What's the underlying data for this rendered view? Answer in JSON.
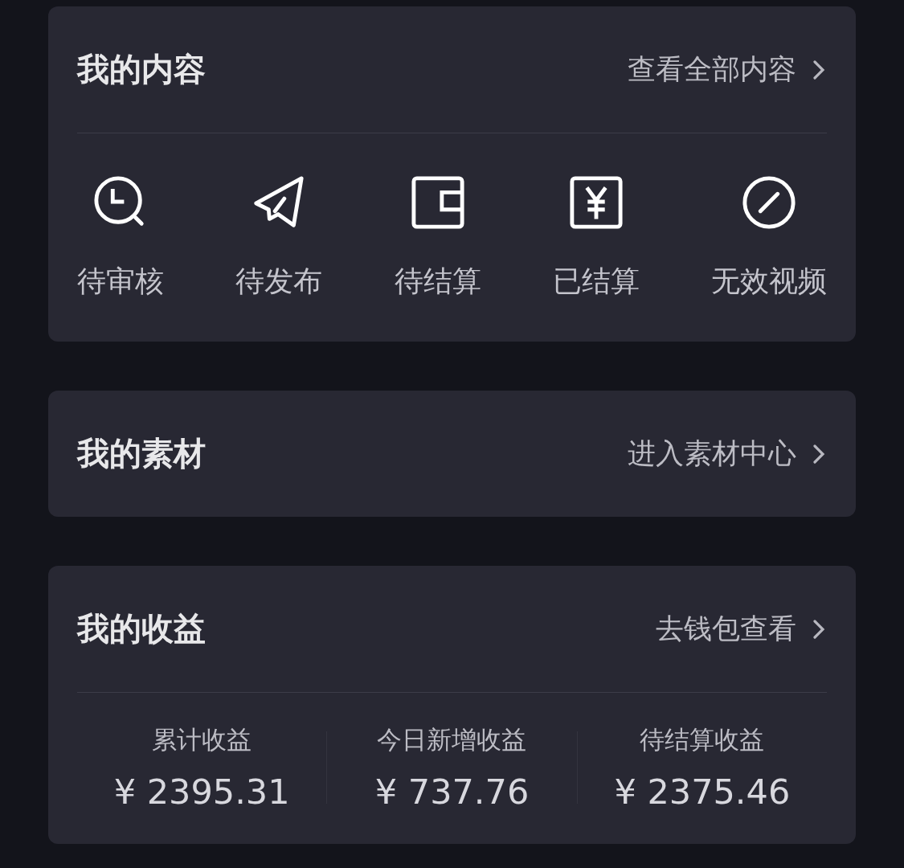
{
  "content_card": {
    "title": "我的内容",
    "link": "查看全部内容",
    "items": [
      {
        "label": "待审核"
      },
      {
        "label": "待发布"
      },
      {
        "label": "待结算"
      },
      {
        "label": "已结算"
      },
      {
        "label": "无效视频"
      }
    ]
  },
  "material_card": {
    "title": "我的素材",
    "link": "进入素材中心"
  },
  "earnings_card": {
    "title": "我的收益",
    "link": "去钱包查看",
    "stats": [
      {
        "label": "累计收益",
        "value": "¥ 2395.31"
      },
      {
        "label": "今日新增收益",
        "value": "¥ 737.76"
      },
      {
        "label": "待结算收益",
        "value": "¥ 2375.46"
      }
    ]
  }
}
